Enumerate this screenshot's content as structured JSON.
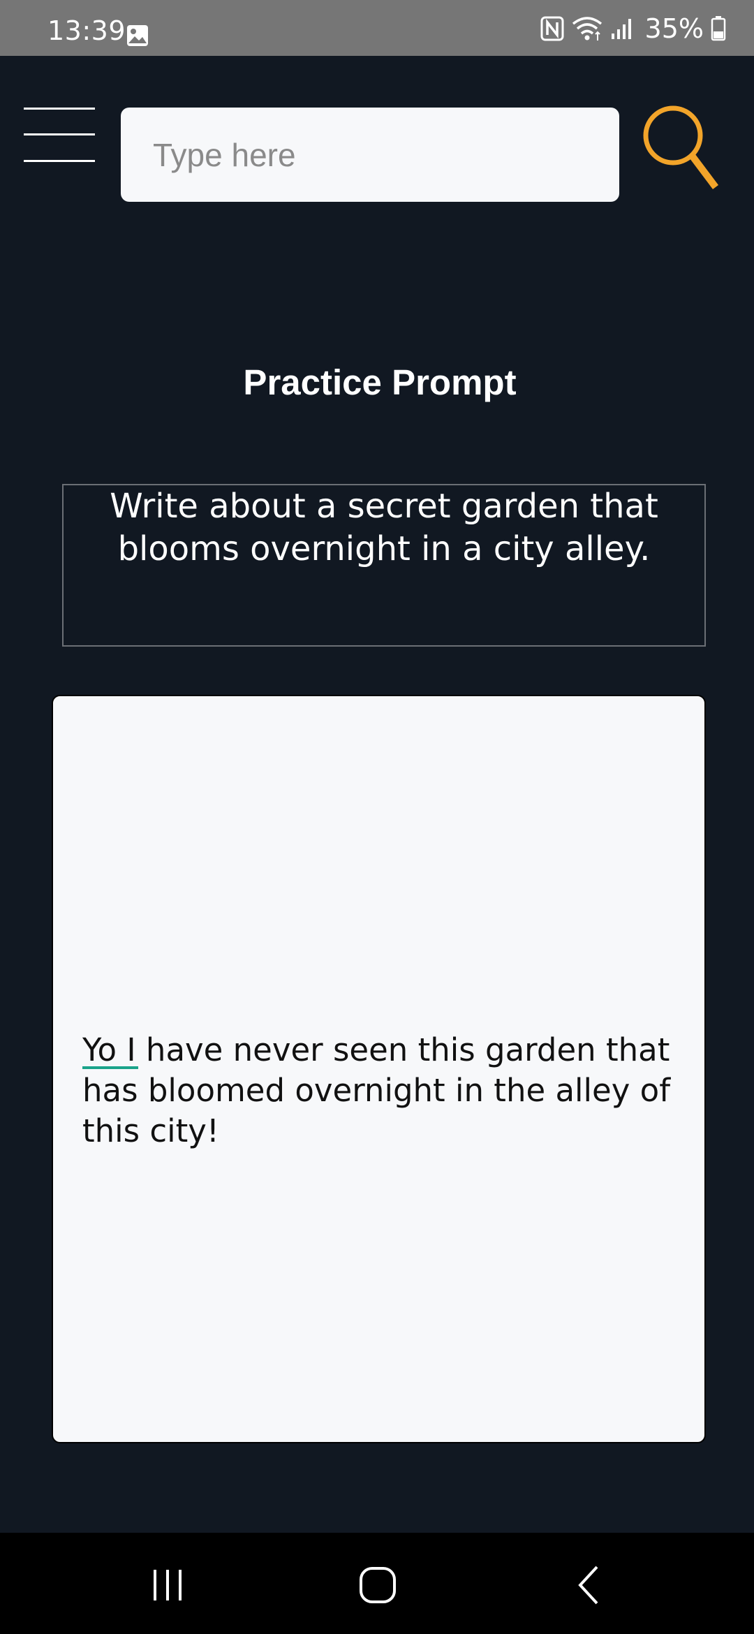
{
  "status_bar": {
    "time": "13:39",
    "battery": "35%",
    "icons": [
      "gallery-icon",
      "nfc-icon",
      "wifi-icon",
      "signal-icon",
      "battery-icon"
    ]
  },
  "header": {
    "menu_icon": "hamburger-menu-icon",
    "search": {
      "placeholder": "Type here",
      "value": ""
    },
    "search_icon": "search-icon",
    "search_icon_color": "#f2a42a"
  },
  "main": {
    "title": "Practice Prompt",
    "prompt": "Write about a secret garden that blooms overnight in a city alley.",
    "response": "Yo I have never seen this garden that has bloomed overnight in the alley of this city!"
  },
  "nav_bar": {
    "buttons": [
      "recent-apps-icon",
      "home-icon",
      "back-icon"
    ]
  },
  "colors": {
    "background": "#111822",
    "status_bar": "#767676",
    "accent": "#f2a42a",
    "spell_mark": "#1aa38a"
  }
}
